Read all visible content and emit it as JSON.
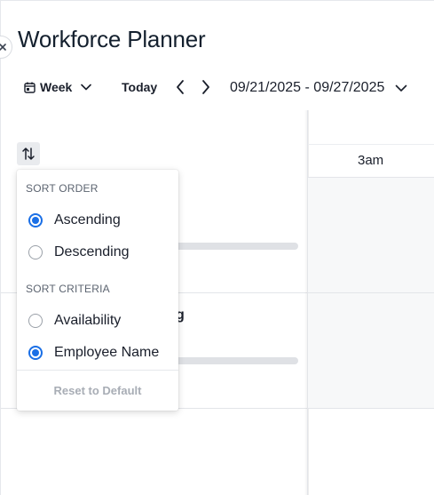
{
  "header": {
    "title": "Workforce Planner"
  },
  "toolbar": {
    "view_label": "Week",
    "today_label": "Today",
    "date_range": "09/21/2025 - 09/27/2025"
  },
  "schedule": {
    "time_slot": "3am",
    "rows": [
      {
        "name_fragment": ""
      },
      {
        "name_fragment": "g"
      }
    ]
  },
  "sort_menu": {
    "order_heading": "SORT ORDER",
    "order_options": [
      {
        "label": "Ascending",
        "selected": true
      },
      {
        "label": "Descending",
        "selected": false
      }
    ],
    "criteria_heading": "SORT CRITERIA",
    "criteria_options": [
      {
        "label": "Availability",
        "selected": false
      },
      {
        "label": "Employee Name",
        "selected": true
      }
    ],
    "reset_label": "Reset to Default"
  },
  "colors": {
    "accent": "#1a6fe6",
    "text": "#1a1f2b",
    "muted": "#a8adb5"
  }
}
